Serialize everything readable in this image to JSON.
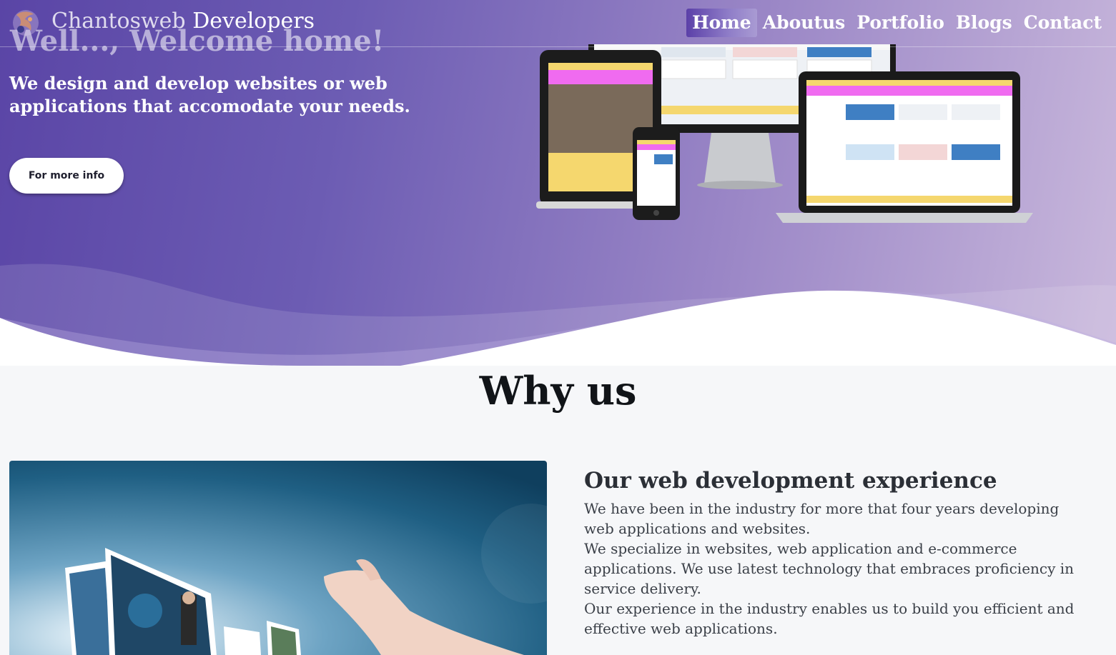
{
  "brand": {
    "part1": "Chantosweb",
    "part2": "Developers"
  },
  "nav": {
    "items": [
      "Home",
      "Aboutus",
      "Portfolio",
      "Blogs",
      "Contact"
    ],
    "active": "Home"
  },
  "hero": {
    "heading": "Well..., Welcome home!",
    "subtitle": "We design and develop websites or web applications that accomodate your needs.",
    "button_label": "For more info"
  },
  "why": {
    "title": "Why us",
    "experience_title": "Our web development experience",
    "paragraphs": [
      "We have been in the industry for more that four years developing web applications and websites.",
      "We specialize in websites, web application and e-commerce applications. We use latest technology that embraces proficiency in service delivery.",
      "Our experience in the industry enables us to build you efficient and effective web applications."
    ]
  },
  "colors": {
    "hero_start": "#5a45a6",
    "hero_end": "#c9b8dc",
    "section_bg": "#f6f7f9",
    "heading_dark": "#111418"
  }
}
